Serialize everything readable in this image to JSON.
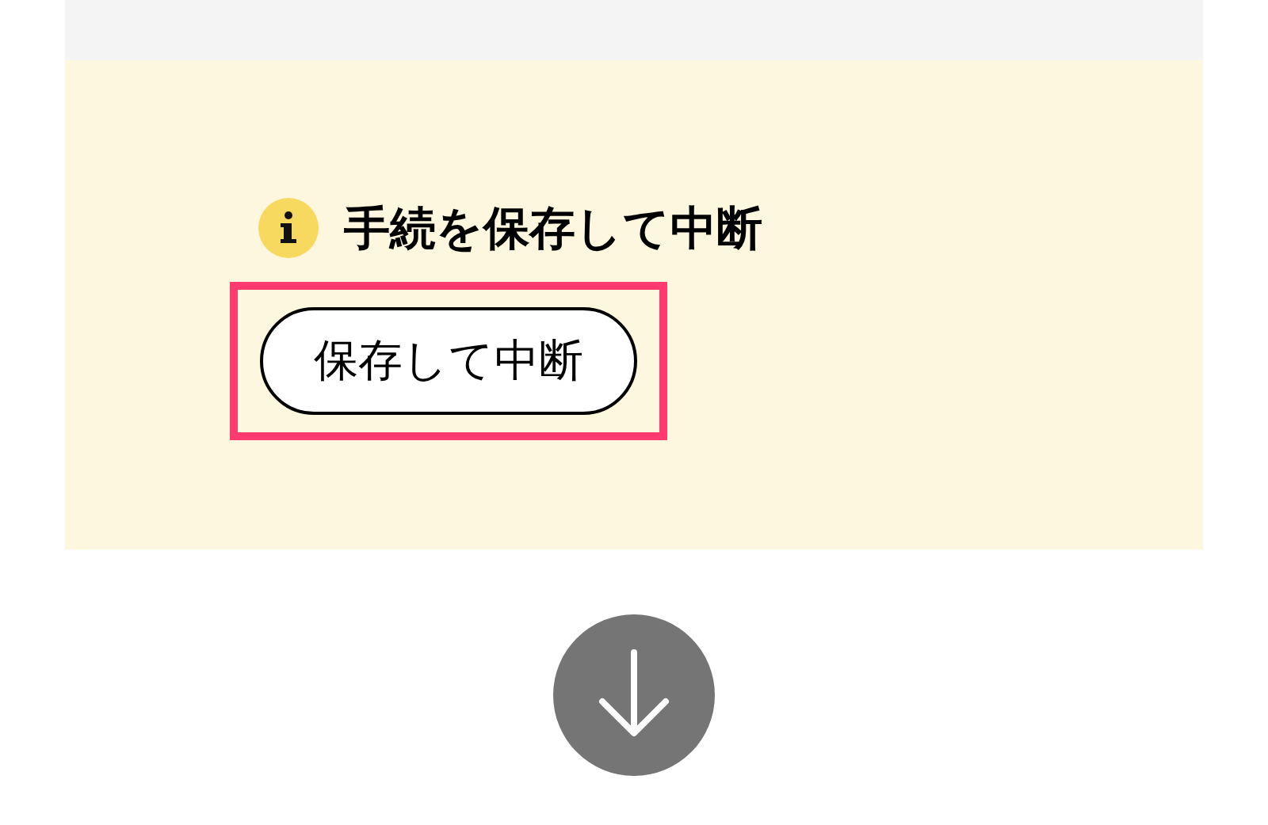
{
  "notice": {
    "heading": "手続を保存して中断",
    "button": {
      "label": "保存して中断",
      "highlighted": true
    }
  }
}
